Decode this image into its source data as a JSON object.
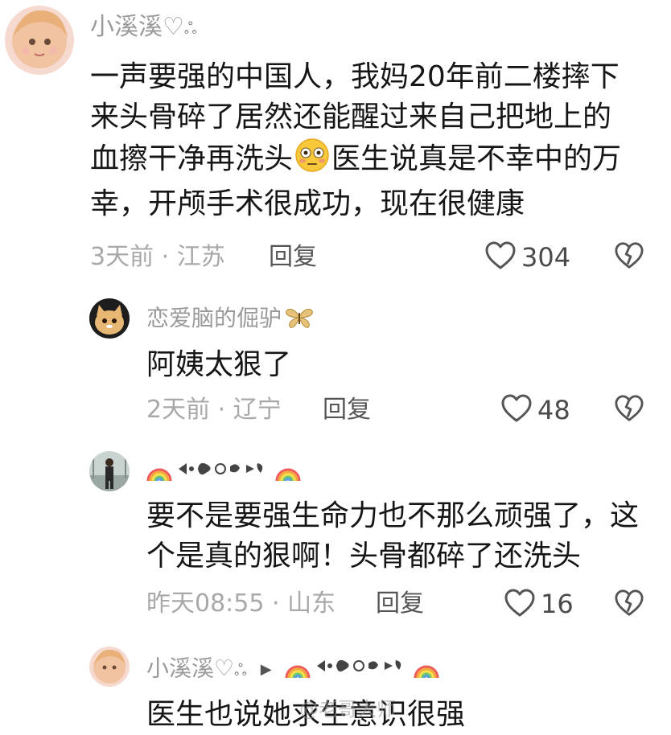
{
  "comments": [
    {
      "author": "小溪溪♡",
      "text_lines": [
        "一声要强的中国人，我妈20年前二楼摔下",
        "来头骨碎了居然还能醒过来自己把地上的",
        "血擦干净再洗头",
        "医生说真是不幸中的万",
        "幸，开颅手术很成功，现在很健康"
      ],
      "emoji": "flushed-face-emoji",
      "time": "3天前",
      "location": "江苏",
      "reply_label": "回复",
      "likes": "304"
    },
    {
      "author": "恋爱脑的倔驴",
      "text": "阿姨太狠了",
      "time": "2天前",
      "location": "辽宁",
      "reply_label": "回复",
      "likes": "48"
    },
    {
      "author_icons": [
        "rainbow-emoji",
        "bow-ornament",
        "rainbow-emoji"
      ],
      "text_lines": [
        "要不是要强生命力也不那么顽强了，这",
        "个是真的狠啊！头骨都碎了还洗头"
      ],
      "time": "昨天08:55",
      "location": "山东",
      "reply_label": "回复",
      "likes": "16"
    },
    {
      "author": "小溪溪♡",
      "reply_arrow": "▶",
      "text": "医生也说她求生意识很强"
    }
  ],
  "separator": "·",
  "watermark": "@老哥大师",
  "colors": {
    "text": "#161616",
    "muted": "#9a9a9a",
    "meta": "#a8a8a8",
    "icon": "#555555"
  }
}
